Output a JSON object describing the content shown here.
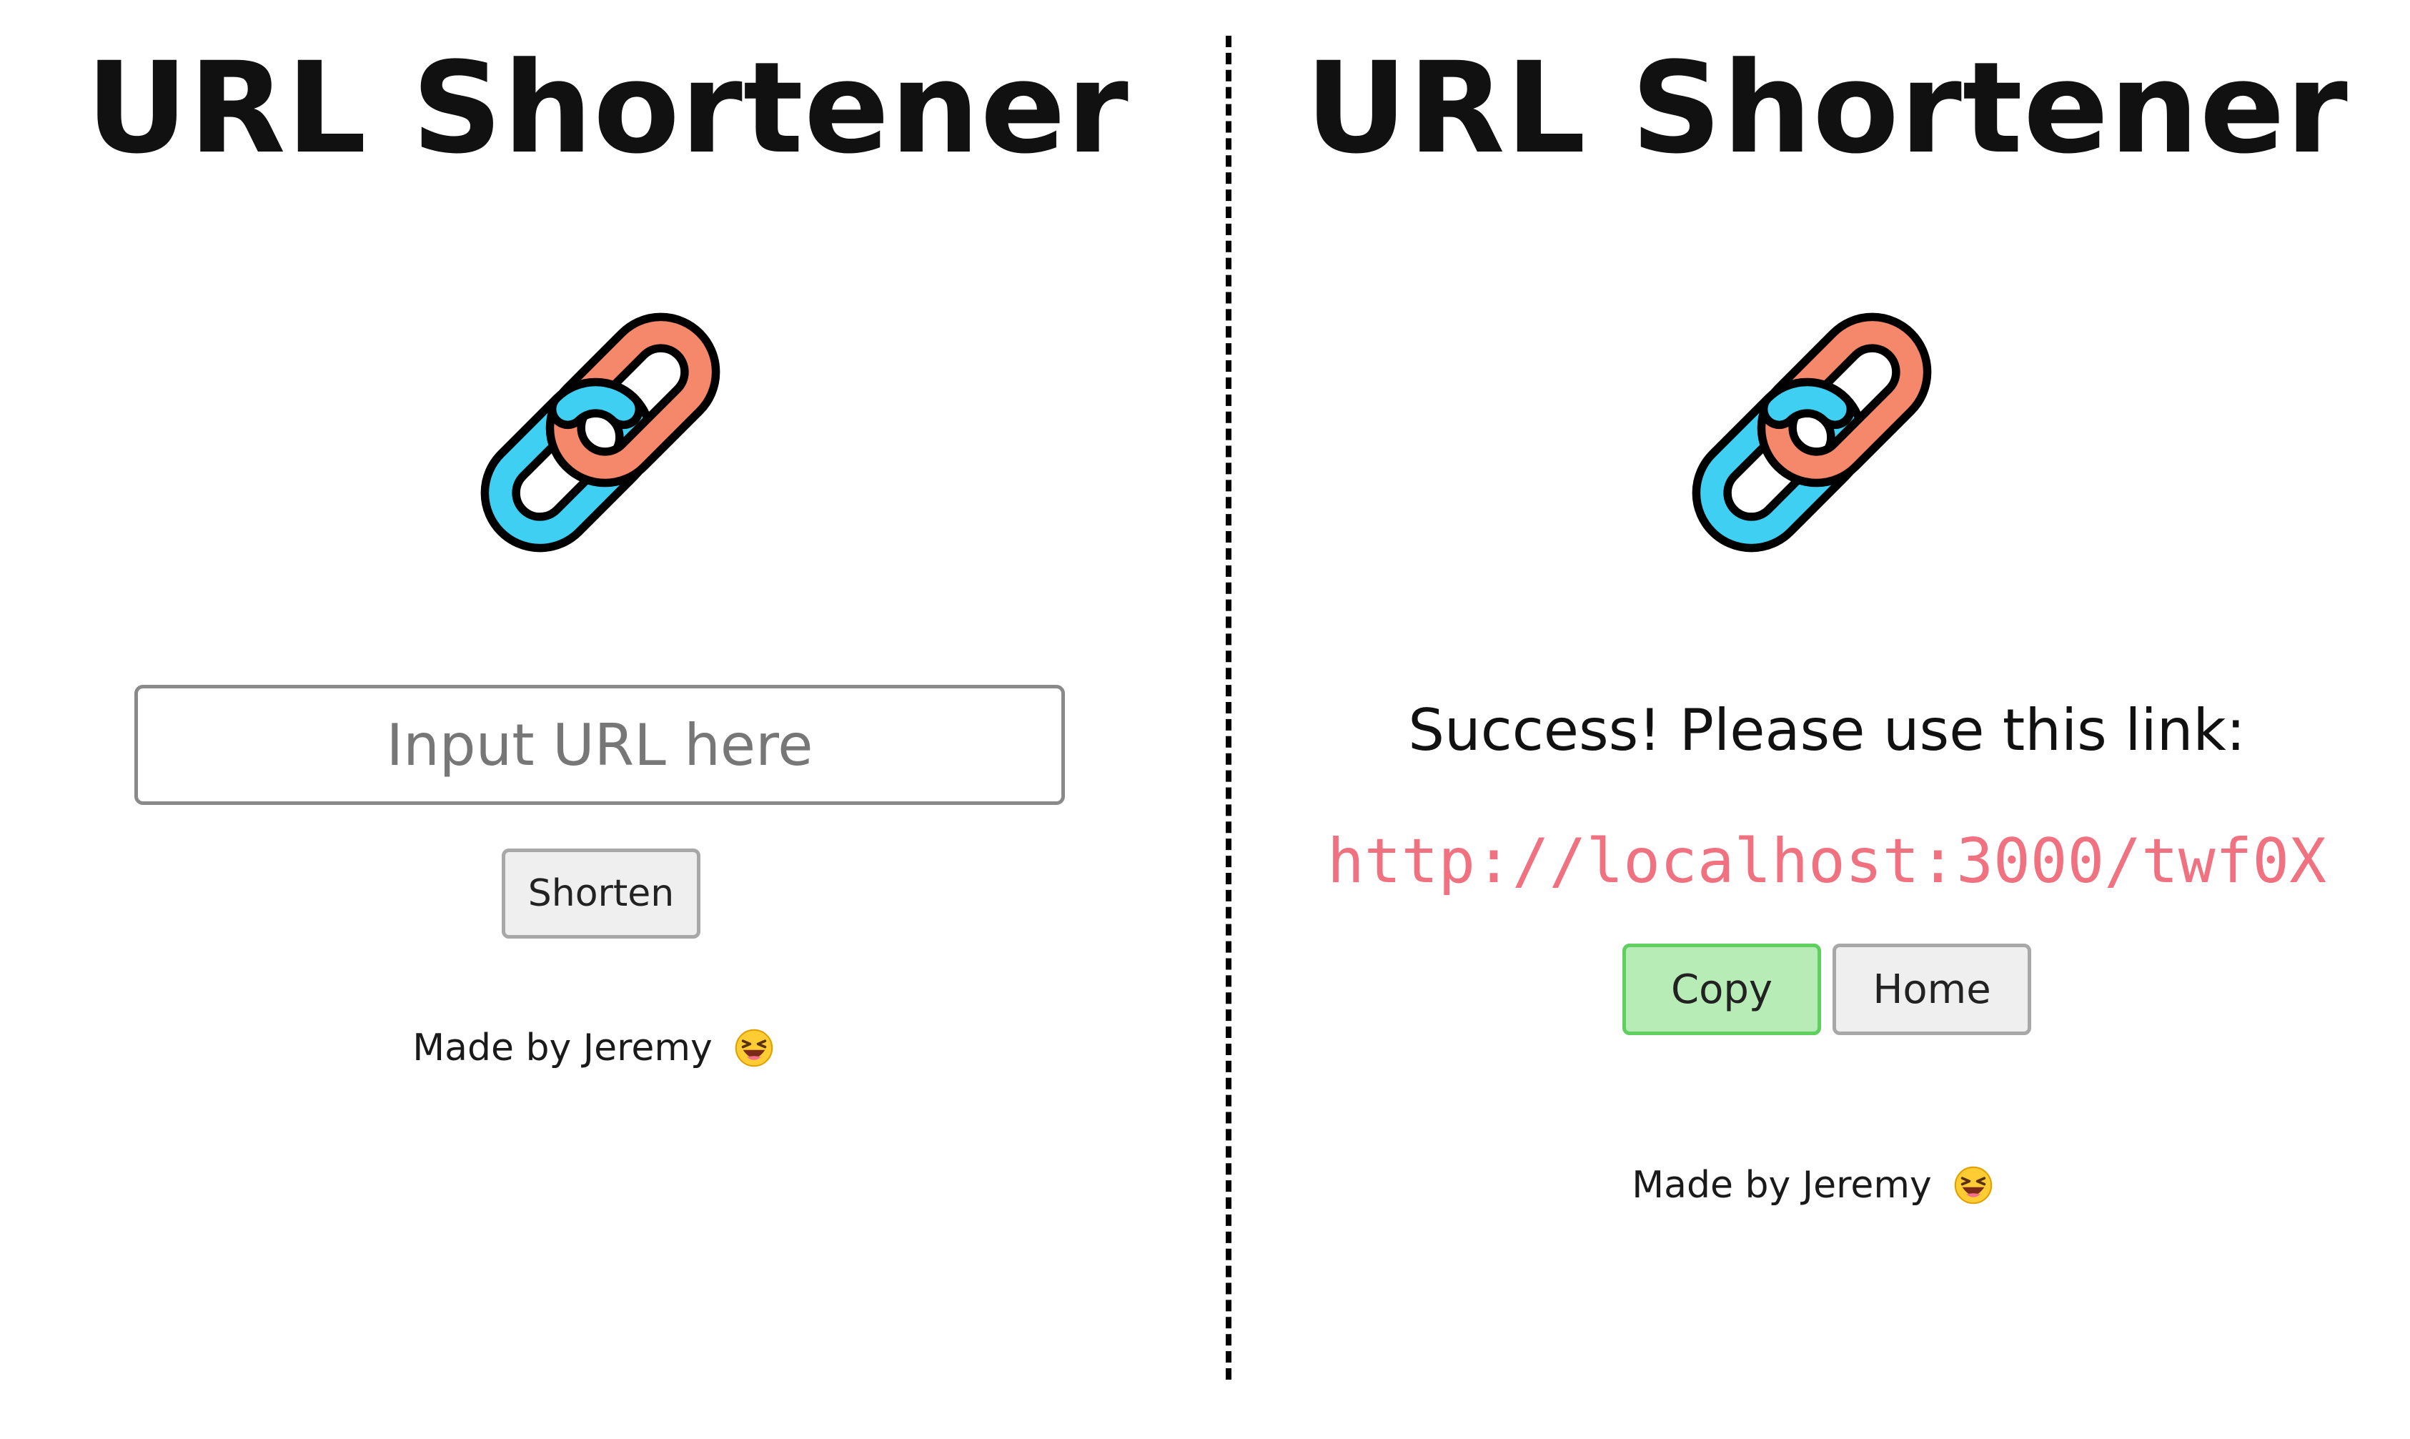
{
  "left": {
    "title": "URL Shortener",
    "logo_icon": "link-chain-icon",
    "input": {
      "placeholder": "Input URL here",
      "value": ""
    },
    "shorten_button_label": "Shorten",
    "footer_text": "Made by Jeremy",
    "footer_icon": "grinning-squinting-face-emoji-icon"
  },
  "right": {
    "title": "URL Shortener",
    "logo_icon": "link-chain-icon",
    "success_message": "Success! Please use this link:",
    "short_url": "http://localhost:3000/twf0X",
    "copy_button_label": "Copy",
    "home_button_label": "Home",
    "footer_text": "Made by Jeremy",
    "footer_icon": "grinning-squinting-face-emoji-icon"
  },
  "colors": {
    "link_text": "#f07280",
    "copy_button_bg": "#b7ecb7",
    "copy_button_border": "#5fcf5f",
    "chain_blue": "#3fcff2",
    "chain_orange": "#f5876a"
  }
}
